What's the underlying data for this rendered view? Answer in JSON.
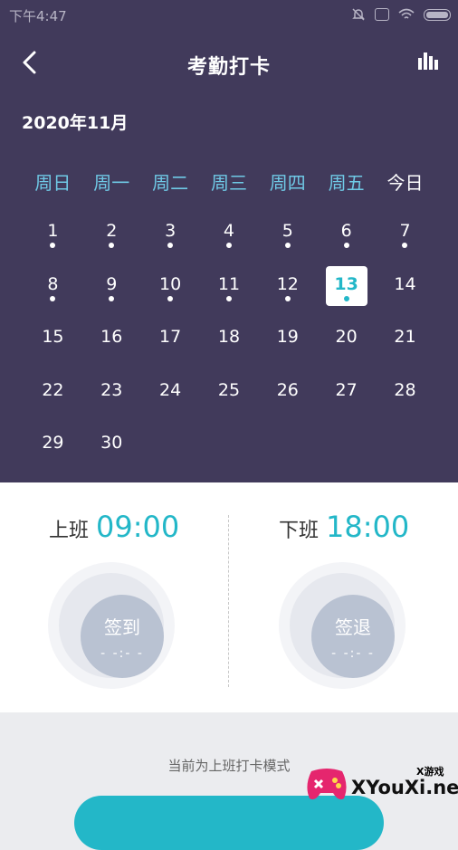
{
  "status_bar": {
    "time": "下午4:47"
  },
  "header": {
    "title": "考勤打卡"
  },
  "calendar": {
    "month": "2020年11月",
    "weekdays": [
      "周日",
      "周一",
      "周二",
      "周三",
      "周四",
      "周五",
      "今日"
    ],
    "days": [
      {
        "n": "1",
        "dot": true
      },
      {
        "n": "2",
        "dot": true
      },
      {
        "n": "3",
        "dot": true
      },
      {
        "n": "4",
        "dot": true
      },
      {
        "n": "5",
        "dot": true
      },
      {
        "n": "6",
        "dot": true
      },
      {
        "n": "7",
        "dot": true
      },
      {
        "n": "8",
        "dot": true
      },
      {
        "n": "9",
        "dot": true
      },
      {
        "n": "10",
        "dot": true
      },
      {
        "n": "11",
        "dot": true
      },
      {
        "n": "12",
        "dot": true
      },
      {
        "n": "13",
        "dot": true,
        "selected": true
      },
      {
        "n": "14",
        "dot": false
      },
      {
        "n": "15",
        "dot": false
      },
      {
        "n": "16",
        "dot": false
      },
      {
        "n": "17",
        "dot": false
      },
      {
        "n": "18",
        "dot": false
      },
      {
        "n": "19",
        "dot": false
      },
      {
        "n": "20",
        "dot": false
      },
      {
        "n": "21",
        "dot": false
      },
      {
        "n": "22",
        "dot": false
      },
      {
        "n": "23",
        "dot": false
      },
      {
        "n": "24",
        "dot": false
      },
      {
        "n": "25",
        "dot": false
      },
      {
        "n": "26",
        "dot": false
      },
      {
        "n": "27",
        "dot": false
      },
      {
        "n": "28",
        "dot": false
      },
      {
        "n": "29",
        "dot": false
      },
      {
        "n": "30",
        "dot": false
      }
    ]
  },
  "clock_in": {
    "label": "上班",
    "time": "09:00",
    "button": "签到",
    "status": "- -:- -"
  },
  "clock_out": {
    "label": "下班",
    "time": "18:00",
    "button": "签退",
    "status": "- -:- -"
  },
  "mode_text": "当前为上班打卡模式",
  "watermark": {
    "small": "X游戏",
    "text": "XYouXi.net"
  },
  "colors": {
    "header_bg": "#413a5b",
    "accent": "#23b7c8",
    "weekday": "#6fc9e6",
    "button_disabled": "#b9c2d2"
  }
}
